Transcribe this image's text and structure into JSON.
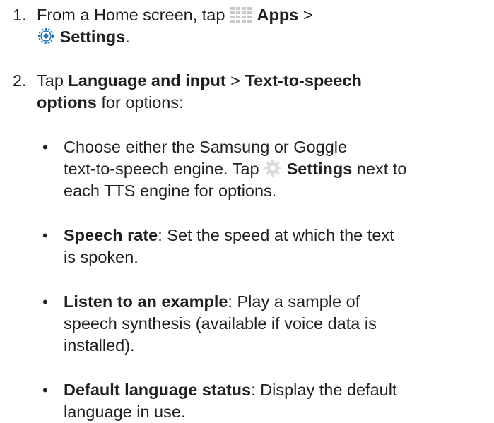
{
  "step1": {
    "number": "1.",
    "line1_a": "From a Home screen, tap ",
    "apps_icon": "apps-grid-icon",
    "apps_label": "Apps",
    "line1_b": " >",
    "settings_icon": "settings-gear-blue-icon",
    "settings_label": "Settings",
    "period": "."
  },
  "step2": {
    "number": "2.",
    "tap": "Tap ",
    "language_input": "Language and input",
    "sep": " > ",
    "tts_line1": "Text-to-speech",
    "tts_line2": "options",
    "for_options": " for options:"
  },
  "bullets": {
    "b1_line1": "Choose either the Samsung or Goggle",
    "b1_line2a": "text-to-speech engine. Tap ",
    "b1_icon": "settings-gear-icon",
    "b1_settings": "Settings",
    "b1_line2b": " next to",
    "b1_line3": "each TTS engine for options.",
    "b2_term": "Speech rate",
    "b2_line1": ": Set the speed at which the text",
    "b2_line2": "is spoken.",
    "b3_term": "Listen to an example",
    "b3_line1": ": Play a sample of",
    "b3_line2": "speech synthesis (available if voice data is",
    "b3_line3": "installed).",
    "b4_term": "Default language status",
    "b4_line1": ": Display the default",
    "b4_line2": "language in use."
  },
  "colors": {
    "text": "#231f20",
    "apps_icon": "#c8c8c8",
    "settings_icon": "#1e6fb3",
    "gear_icon": "#d8dce0"
  }
}
